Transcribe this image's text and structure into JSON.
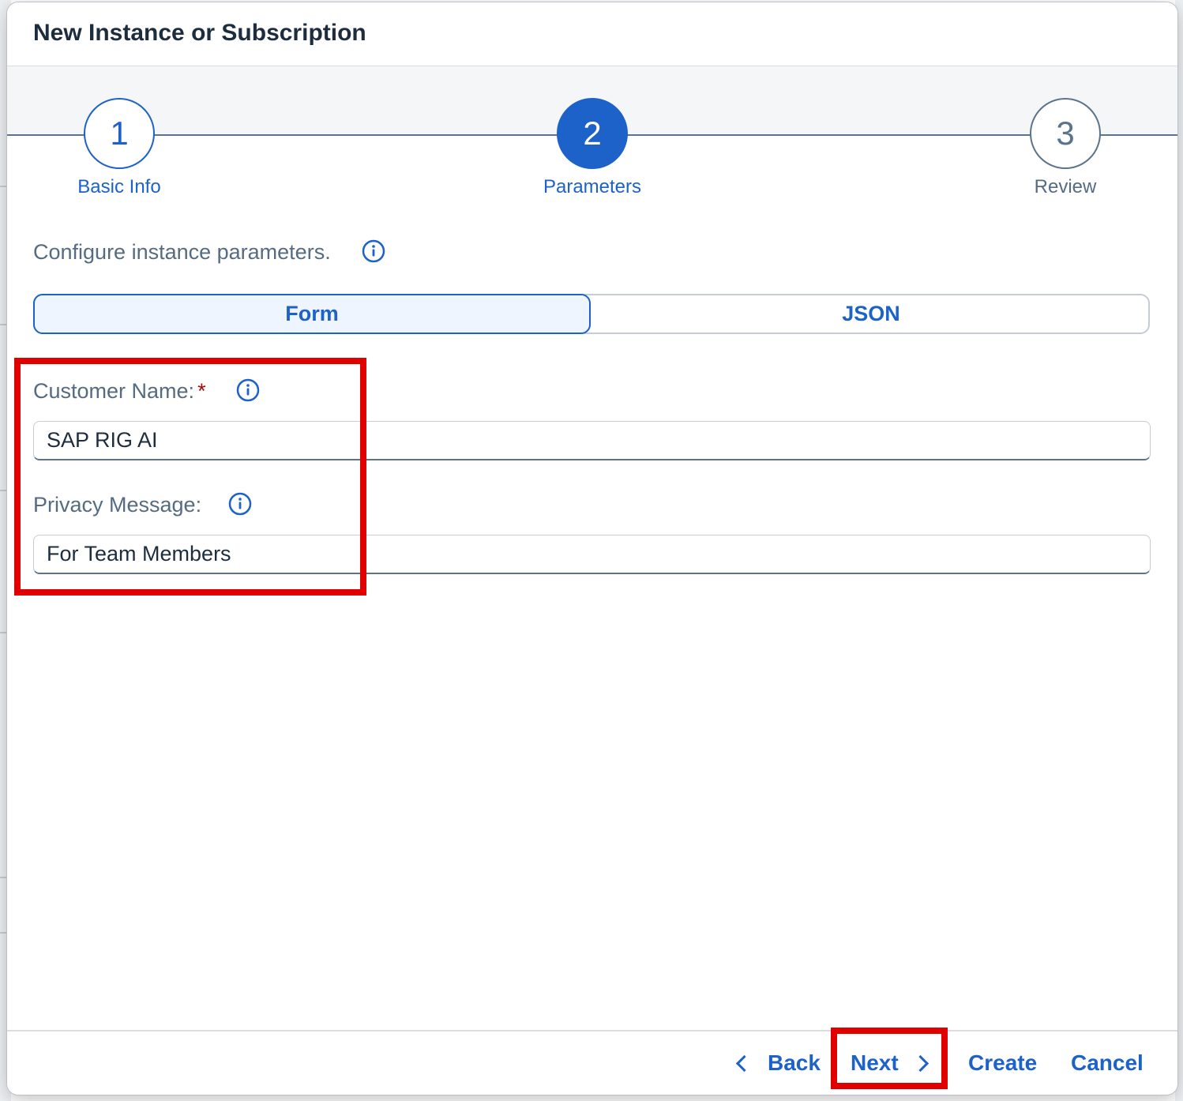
{
  "dialog": {
    "title": "New Instance or Subscription"
  },
  "wizard": {
    "steps": [
      {
        "number": "1",
        "label": "Basic Info",
        "state": "completed"
      },
      {
        "number": "2",
        "label": "Parameters",
        "state": "active"
      },
      {
        "number": "3",
        "label": "Review",
        "state": "upcoming"
      }
    ]
  },
  "intro": {
    "text": "Configure instance parameters."
  },
  "mode_toggle": {
    "options": [
      "Form",
      "JSON"
    ],
    "selected": "Form"
  },
  "form": {
    "customer_name": {
      "label": "Customer Name:",
      "required_marker": "*",
      "value": "SAP RIG AI"
    },
    "privacy_message": {
      "label": "Privacy Message:",
      "value": "For Team Members"
    }
  },
  "footer": {
    "back_label": "Back",
    "next_label": "Next",
    "create_label": "Create",
    "cancel_label": "Cancel"
  },
  "colors": {
    "accent": "#1d62c8",
    "highlight": "#e00000",
    "required": "#aa0808"
  },
  "icons": {
    "info": "info-circle-icon",
    "back": "chevron-left-icon",
    "next": "chevron-right-icon"
  }
}
